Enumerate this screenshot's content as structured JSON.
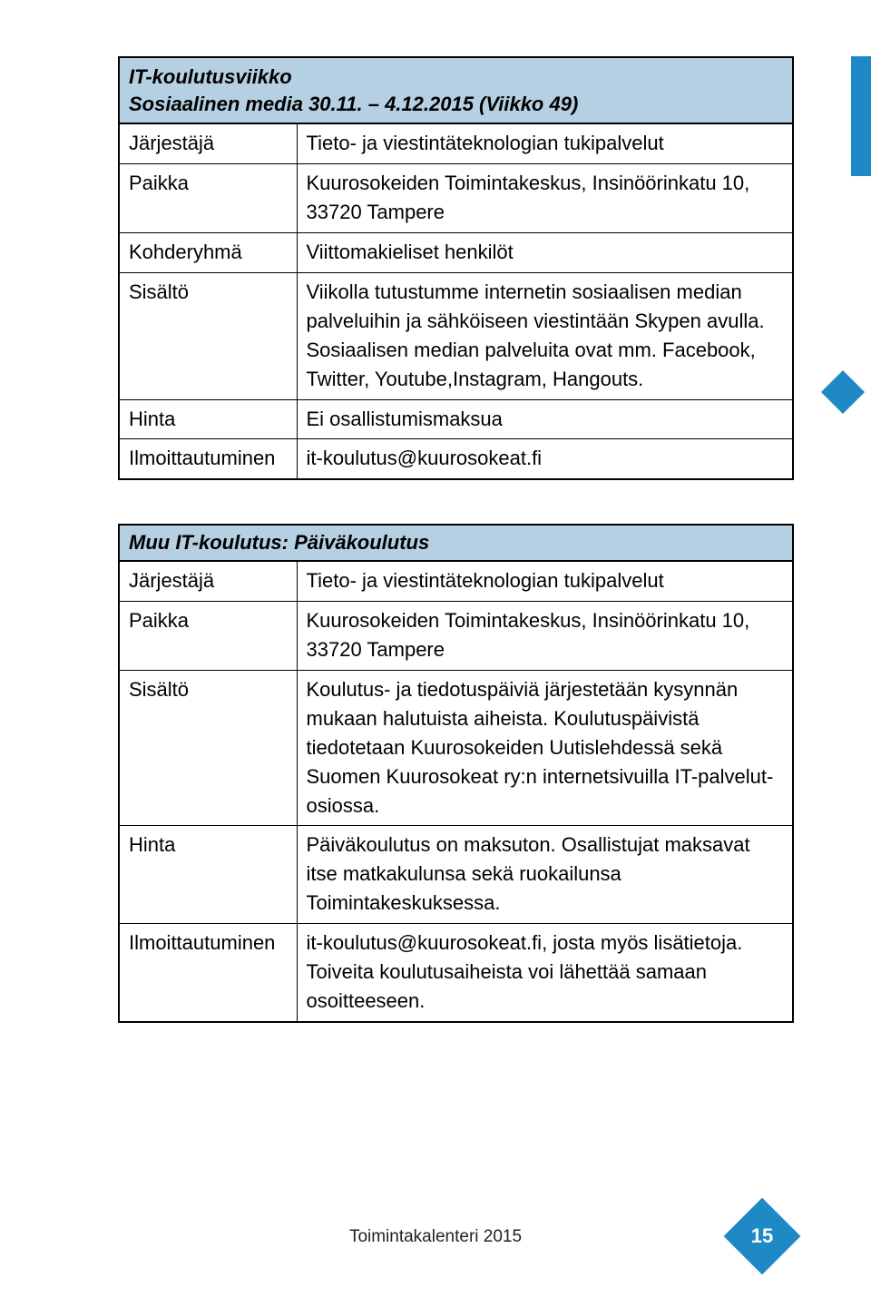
{
  "table1": {
    "title_line1": "IT-koulutusviikko",
    "title_line2": "Sosiaalinen media 30.11. – 4.12.2015 (Viikko 49)",
    "rows": {
      "jarjestaja_label": "Järjestäjä",
      "jarjestaja_value": "Tieto- ja viestintäteknologian tukipalvelut",
      "paikka_label": "Paikka",
      "paikka_value": "Kuurosokeiden Toimintakeskus, Insinöörinkatu 10, 33720 Tampere",
      "kohderyhma_label": "Kohderyhmä",
      "kohderyhma_value": "Viittomakieliset henkilöt",
      "sisalto_label": "Sisältö",
      "sisalto_value": "Viikolla tutustumme internetin sosiaalisen median palveluihin ja sähköiseen viestintään Skypen avulla. Sosiaalisen median palveluita ovat mm. Facebook, Twitter, Youtube,Instagram, Hangouts.",
      "hinta_label": "Hinta",
      "hinta_value": "Ei osallistumismaksua",
      "ilmoitt_label": "Ilmoittautuminen",
      "ilmoitt_value": "it-koulutus@kuurosokeat.fi"
    }
  },
  "table2": {
    "title": "Muu IT-koulutus: Päiväkoulutus",
    "rows": {
      "jarjestaja_label": "Järjestäjä",
      "jarjestaja_value": "Tieto- ja viestintäteknologian tukipalvelut",
      "paikka_label": "Paikka",
      "paikka_value": "Kuurosokeiden Toimintakeskus, Insinöörinkatu 10, 33720 Tampere",
      "sisalto_label": "Sisältö",
      "sisalto_value": "Koulutus- ja tiedotuspäiviä järjestetään kysynnän mukaan halutuista aiheista. Koulutuspäivistä tiedotetaan Kuurosokeiden Uutislehdessä sekä Suomen Kuurosokeat ry:n internetsivuilla IT-palvelut-osiossa.",
      "hinta_label": "Hinta",
      "hinta_value": "Päiväkoulutus on maksuton. Osallistujat maksavat itse matkakulunsa sekä ruokailunsa Toimintakeskuksessa.",
      "ilmoitt_label": "Ilmoittautuminen",
      "ilmoitt_value": "it-koulutus@kuurosokeat.fi, josta myös lisätietoja. Toiveita koulutusaiheista voi lähettää samaan osoitteeseen."
    }
  },
  "footer": {
    "text": "Toimintakalenteri 2015",
    "page_number": "15"
  }
}
